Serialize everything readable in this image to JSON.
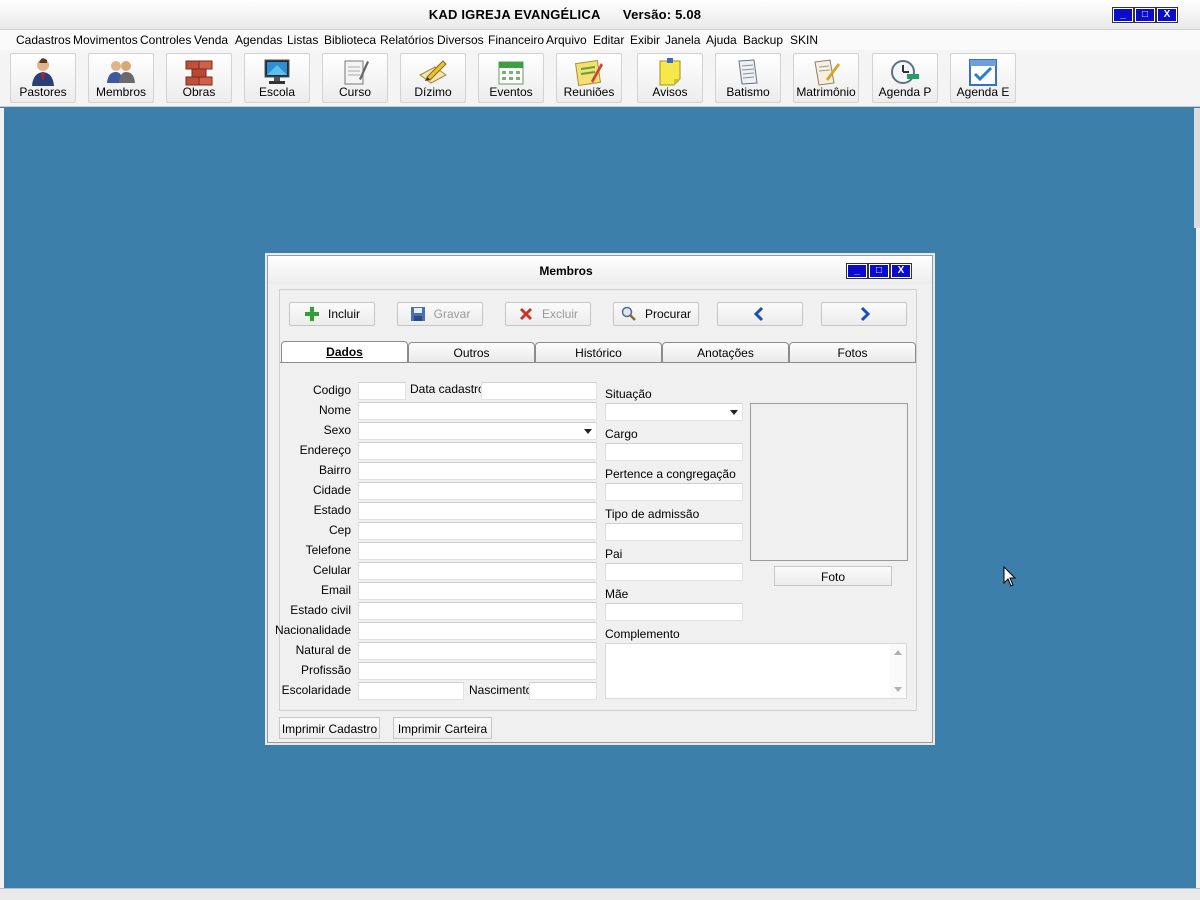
{
  "window": {
    "title": "KAD IGREJA EVANGÉLICA      Versão: 5.08",
    "controls": {
      "minimize": "_",
      "maximize": "□",
      "close": "X"
    }
  },
  "menu": [
    "Cadastros",
    "Movimentos",
    "Controles",
    "Venda",
    "Agendas",
    "Listas",
    "Biblioteca",
    "Relatórios",
    "Diversos",
    "Financeiro",
    "Arquivo",
    "Editar",
    "Exibir",
    "Janela",
    "Ajuda",
    "Backup",
    "SKIN"
  ],
  "toolbar": [
    {
      "label": "Pastores",
      "icon": "pastor-icon"
    },
    {
      "label": "Membros",
      "icon": "members-icon"
    },
    {
      "label": "Obras",
      "icon": "bricks-icon"
    },
    {
      "label": "Escola",
      "icon": "monitor-icon"
    },
    {
      "label": "Curso",
      "icon": "notebook-icon"
    },
    {
      "label": "Dízimo",
      "icon": "pencil-paper-icon"
    },
    {
      "label": "Eventos",
      "icon": "calendar-icon"
    },
    {
      "label": "Reuniões",
      "icon": "notes-icon"
    },
    {
      "label": "Avisos",
      "icon": "sticky-note-icon"
    },
    {
      "label": "Batismo",
      "icon": "document-icon"
    },
    {
      "label": "Matrimônio",
      "icon": "certificate-icon"
    },
    {
      "label": "Agenda P",
      "icon": "clock-icon"
    },
    {
      "label": "Agenda E",
      "icon": "checkbox-icon"
    }
  ],
  "form": {
    "title": "Membros",
    "actions": {
      "incluir": "Incluir",
      "gravar": "Gravar",
      "excluir": "Excluir",
      "procurar": "Procurar"
    },
    "tabs": [
      "Dados",
      "Outros",
      "Histórico",
      "Anotações",
      "Fotos"
    ],
    "active_tab": "Dados",
    "left_labels": {
      "codigo": "Codigo",
      "data_cadastro": "Data cadastro",
      "nome": "Nome",
      "sexo": "Sexo",
      "endereco": "Endereço",
      "bairro": "Bairro",
      "cidade": "Cidade",
      "estado": "Estado",
      "cep": "Cep",
      "telefone": "Telefone",
      "celular": "Celular",
      "email": "Email",
      "estado_civil": "Estado civil",
      "nacionalidade": "Nacionalidade",
      "natural_de": "Natural de",
      "profissao": "Profissão",
      "escolaridade": "Escolaridade",
      "nascimento": "Nascimento"
    },
    "right_labels": {
      "situacao": "Situação",
      "cargo": "Cargo",
      "congregacao": "Pertence a congregação",
      "tipo_admissao": "Tipo de admissão",
      "pai": "Pai",
      "mae": "Mãe",
      "complemento": "Complemento"
    },
    "foto_button": "Foto",
    "print_cadastro": "Imprimir Cadastro",
    "print_carteira": "Imprimir Carteira"
  }
}
